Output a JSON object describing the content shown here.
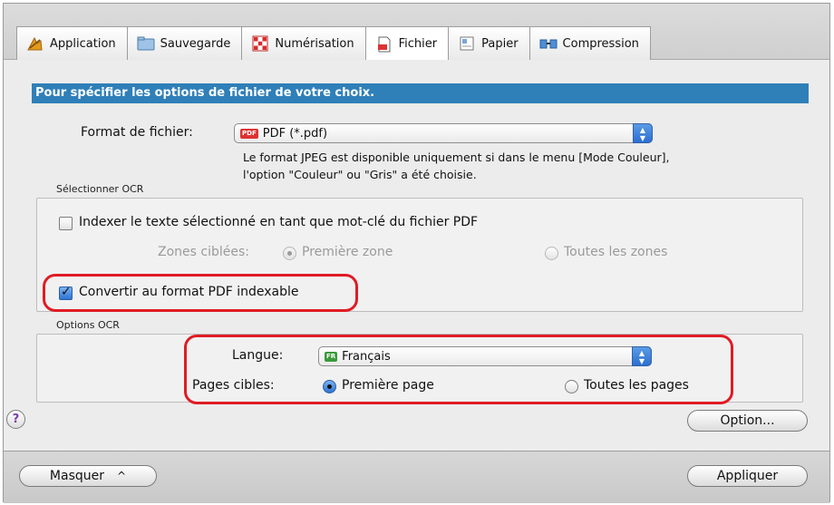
{
  "tabs": [
    {
      "label": "Application",
      "icon": "application-icon"
    },
    {
      "label": "Sauvegarde",
      "icon": "folder-icon"
    },
    {
      "label": "Numérisation",
      "icon": "scan-icon"
    },
    {
      "label": "Fichier",
      "icon": "file-icon",
      "active": true
    },
    {
      "label": "Papier",
      "icon": "paper-icon"
    },
    {
      "label": "Compression",
      "icon": "compression-icon"
    }
  ],
  "header": "Pour spécifier les options de fichier de votre choix.",
  "file_format": {
    "label": "Format de fichier:",
    "value": "PDF (*.pdf)",
    "badge": "PDF",
    "note_line1": "Le format JPEG est disponible uniquement si dans le menu [Mode Couleur],",
    "note_line2": "l'option \"Couleur\" ou \"Gris\" a été choisie."
  },
  "ocr_select": {
    "group_label": "Sélectionner OCR",
    "index_checkbox": "Indexer le texte sélectionné en tant que mot-clé du fichier PDF",
    "zones_label": "Zones ciblées:",
    "zone_first": "Première zone",
    "zone_all": "Toutes les zones",
    "convert_checkbox": "Convertir au format PDF indexable"
  },
  "ocr_options": {
    "group_label": "Options OCR",
    "language_label": "Langue:",
    "language_value": "Français",
    "language_badge": "FR",
    "pages_label": "Pages cibles:",
    "page_first": "Première page",
    "page_all": "Toutes les pages"
  },
  "buttons": {
    "help": "?",
    "option": "Option...",
    "hide": "Masquer",
    "hide_chevron": "^",
    "apply": "Appliquer"
  },
  "colors": {
    "header_bg": "#2f7fb8",
    "highlight": "#e01b24"
  }
}
